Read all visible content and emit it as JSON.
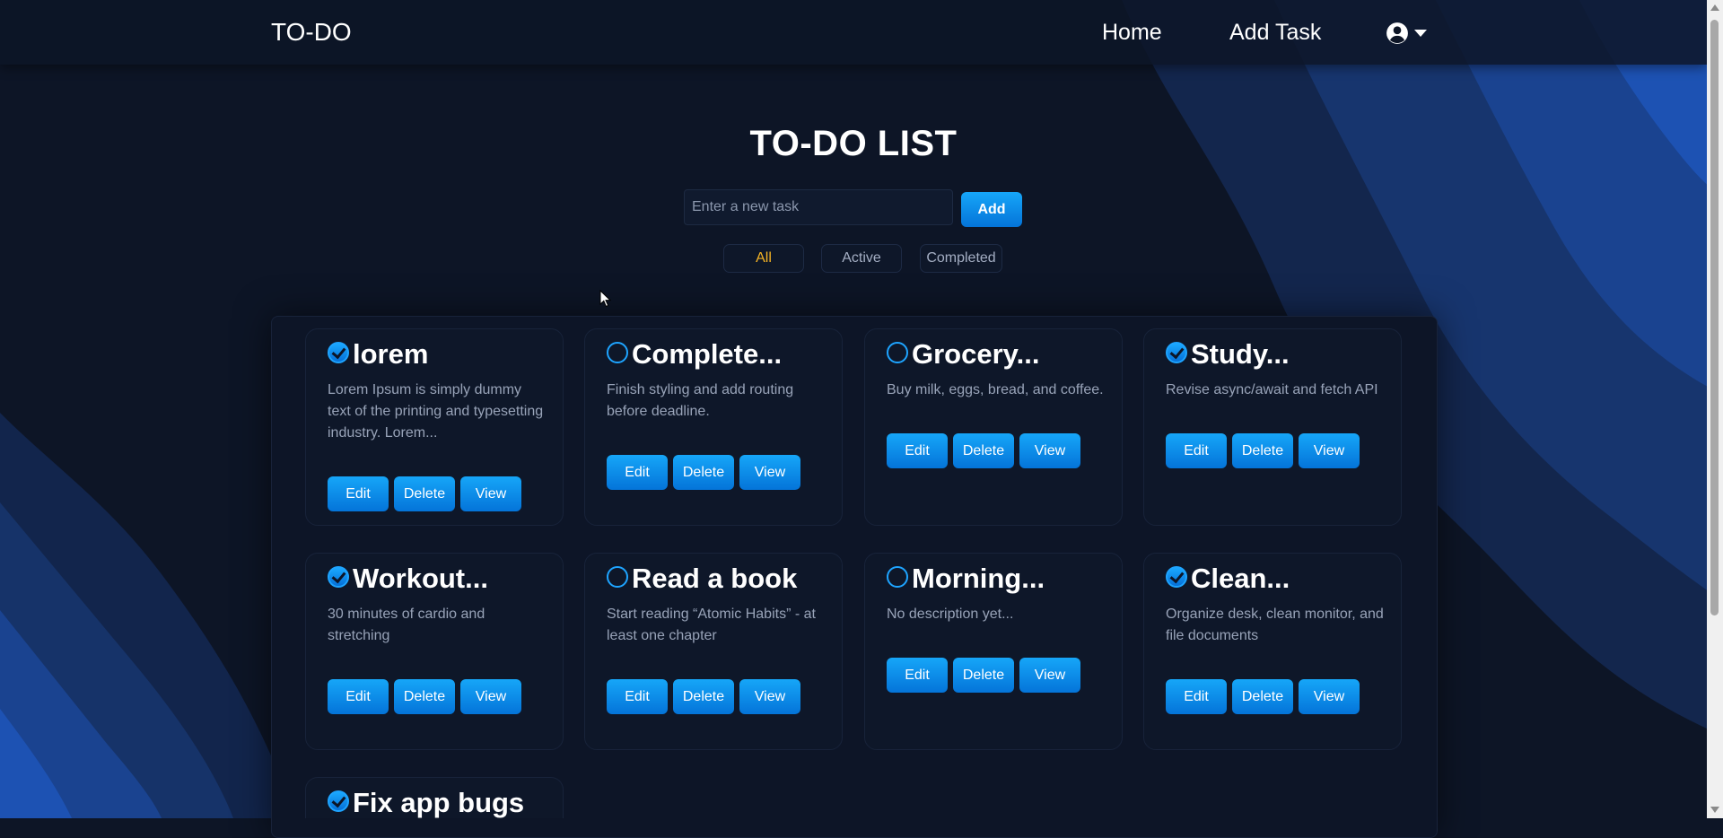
{
  "navbar": {
    "brand": "TO-DO",
    "links": [
      "Home",
      "Add Task"
    ],
    "user_icon": "user-circle-icon"
  },
  "main": {
    "title": "TO-DO LIST",
    "input_placeholder": "Enter a new task",
    "add_label": "Add",
    "filters": [
      "All",
      "Active",
      "Completed"
    ],
    "active_filter": "All"
  },
  "buttons": {
    "edit": "Edit",
    "delete": "Delete",
    "view": "View"
  },
  "tasks": [
    {
      "title": "lorem",
      "description": "Lorem Ipsum is simply dummy text of the printing and typesetting industry. Lorem...",
      "completed": true
    },
    {
      "title": "Complete...",
      "description": "Finish styling and add routing before deadline.",
      "completed": false
    },
    {
      "title": "Grocery...",
      "description": "Buy milk, eggs, bread, and coffee.",
      "completed": false
    },
    {
      "title": "Study...",
      "description": "Revise async/await and fetch API",
      "completed": true
    },
    {
      "title": "Workout...",
      "description": "30 minutes of cardio and stretching",
      "completed": true
    },
    {
      "title": "Read a book",
      "description": "Start reading “Atomic Habits” - at least one chapter",
      "completed": false
    },
    {
      "title": "Morning...",
      "description": "No description yet...",
      "completed": false
    },
    {
      "title": "Clean...",
      "description": "Organize desk, clean monitor, and file documents",
      "completed": true
    },
    {
      "title": "Fix app bugs",
      "description": "",
      "completed": true
    }
  ],
  "colors": {
    "background": "#0d1526",
    "wave_light": "#1c4fb0",
    "accent": "#0c8ef0",
    "active_filter": "#f5b324"
  }
}
